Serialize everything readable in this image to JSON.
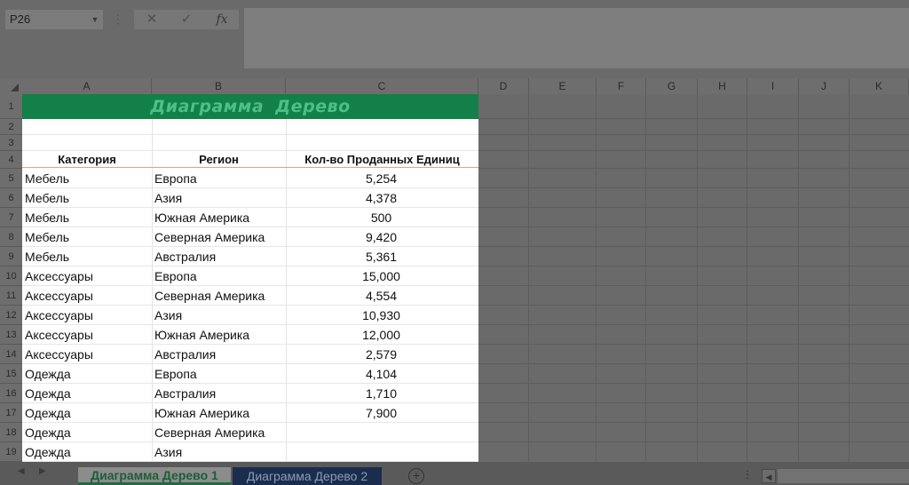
{
  "formula_bar": {
    "name_box": "P26",
    "cancel_glyph": "✕",
    "enter_glyph": "✓",
    "fx_label": "fx",
    "formula_value": ""
  },
  "columns": [
    "A",
    "B",
    "C",
    "D",
    "E",
    "F",
    "G",
    "H",
    "I",
    "J",
    "K"
  ],
  "rows": [
    "1",
    "2",
    "3",
    "4",
    "5",
    "6",
    "7",
    "8",
    "9",
    "10",
    "11",
    "12",
    "13",
    "14",
    "15",
    "16",
    "17",
    "18",
    "19"
  ],
  "sheet": {
    "title": "Диаграмма  Дерево",
    "headers": [
      "Категория",
      "Регион",
      "Кол-во Проданных Единиц"
    ],
    "data": [
      [
        "Мебель",
        "Европа",
        "5,254"
      ],
      [
        "Мебель",
        "Азия",
        "4,378"
      ],
      [
        "Мебель",
        "Южная Америка",
        "500"
      ],
      [
        "Мебель",
        "Северная Америка",
        "9,420"
      ],
      [
        "Мебель",
        "Австралия",
        "5,361"
      ],
      [
        "Аксессуары",
        "Европа",
        "15,000"
      ],
      [
        "Аксессуары",
        "Северная Америка",
        "4,554"
      ],
      [
        "Аксессуары",
        "Азия",
        "10,930"
      ],
      [
        "Аксессуары",
        "Южная Америка",
        "12,000"
      ],
      [
        "Аксессуары",
        "Австралия",
        "2,579"
      ],
      [
        "Одежда",
        "Европа",
        "4,104"
      ],
      [
        "Одежда",
        "Австралия",
        "1,710"
      ],
      [
        "Одежда",
        "Южная Америка",
        "7,900"
      ],
      [
        "Одежда",
        "Северная Америка",
        ""
      ],
      [
        "Одежда",
        "Азия",
        ""
      ]
    ]
  },
  "tabs": {
    "active": "Диаграмма Дерево 1",
    "other": "Диаграмма Дерево 2",
    "add_glyph": "+"
  },
  "colors": {
    "title_fill": "#128048",
    "title_text": "#4fbf86",
    "header_underline": "#e8a280",
    "active_tab_text": "#1b5e36",
    "other_tab_fill": "#1a2d4f"
  }
}
